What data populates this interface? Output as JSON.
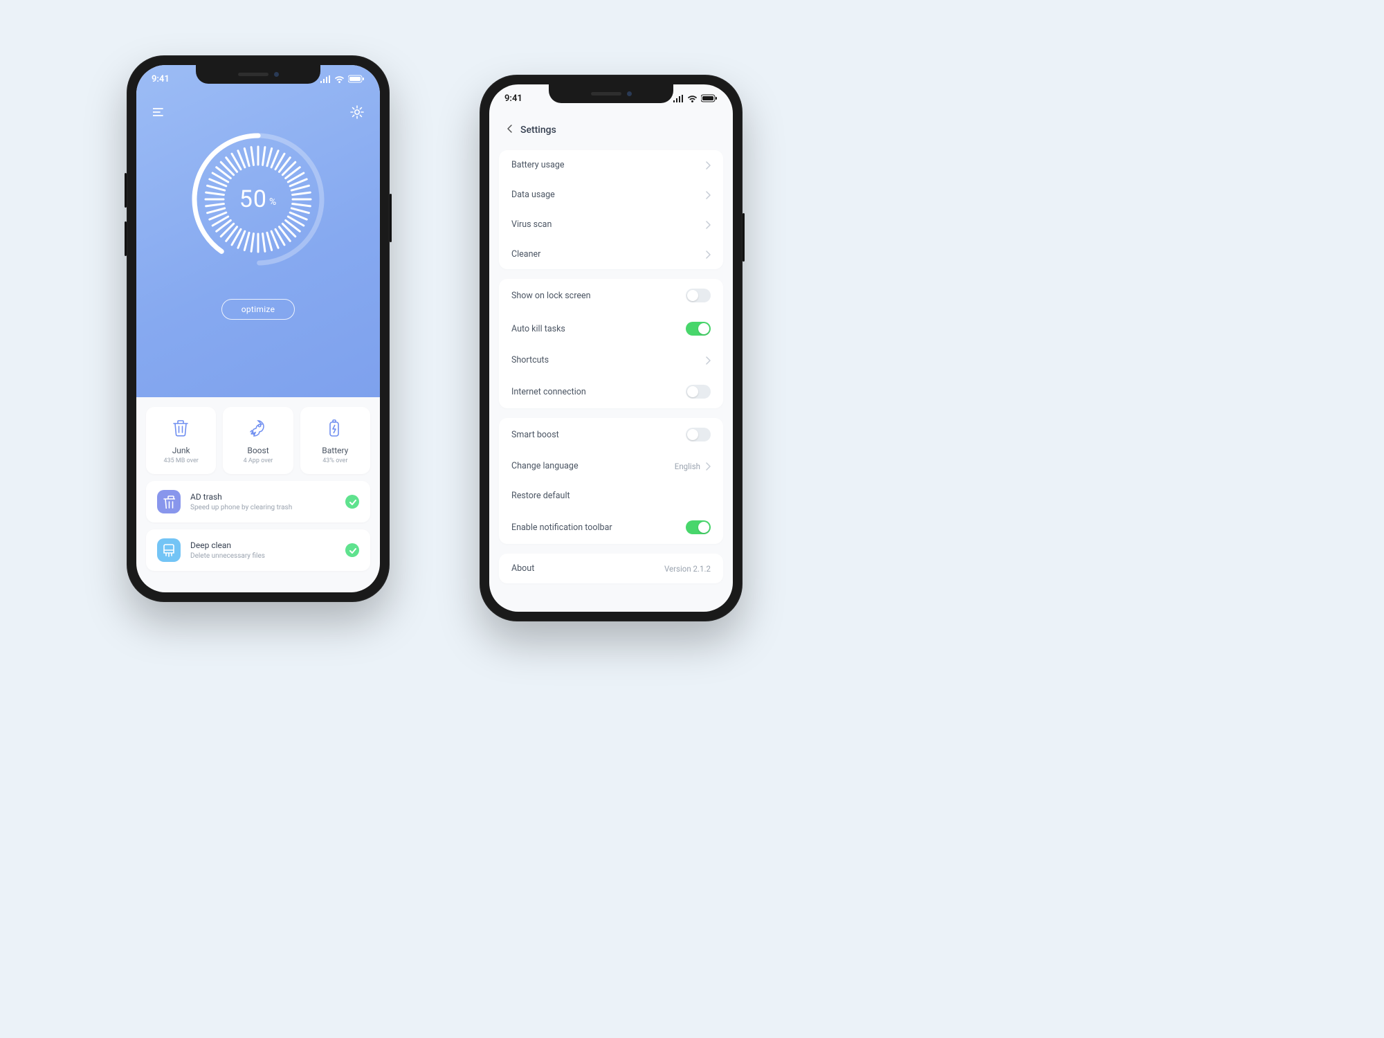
{
  "status": {
    "time": "9:41"
  },
  "home": {
    "percent": "50",
    "percent_unit": "%",
    "optimize_label": "optimize",
    "cards": [
      {
        "icon": "trash",
        "title": "Junk",
        "sub": "435 MB over"
      },
      {
        "icon": "rocket",
        "title": "Boost",
        "sub": "4 App over"
      },
      {
        "icon": "battery",
        "title": "Battery",
        "sub": "43% over"
      }
    ],
    "items": [
      {
        "icon": "trash",
        "title": "AD trash",
        "sub": "Speed up phone by clearing trash",
        "done": true
      },
      {
        "icon": "brush",
        "title": "Deep clean",
        "sub": "Delete unnecessary files",
        "done": true
      }
    ]
  },
  "settings": {
    "title": "Settings",
    "groups": [
      [
        {
          "label": "Battery usage",
          "type": "nav"
        },
        {
          "label": "Data usage",
          "type": "nav"
        },
        {
          "label": "Virus scan",
          "type": "nav"
        },
        {
          "label": "Cleaner",
          "type": "nav"
        }
      ],
      [
        {
          "label": "Show on lock screen",
          "type": "toggle",
          "on": false
        },
        {
          "label": "Auto kill tasks",
          "type": "toggle",
          "on": true
        },
        {
          "label": "Shortcuts",
          "type": "nav"
        },
        {
          "label": "Internet connection",
          "type": "toggle",
          "on": false
        }
      ],
      [
        {
          "label": "Smart boost",
          "type": "toggle",
          "on": false
        },
        {
          "label": "Change language",
          "type": "nav",
          "meta": "English"
        },
        {
          "label": "Restore default",
          "type": "plain"
        },
        {
          "label": "Enable notification toolbar",
          "type": "toggle",
          "on": true
        }
      ],
      [
        {
          "label": "About",
          "type": "meta",
          "meta": "Version 2.1.2"
        }
      ]
    ]
  }
}
